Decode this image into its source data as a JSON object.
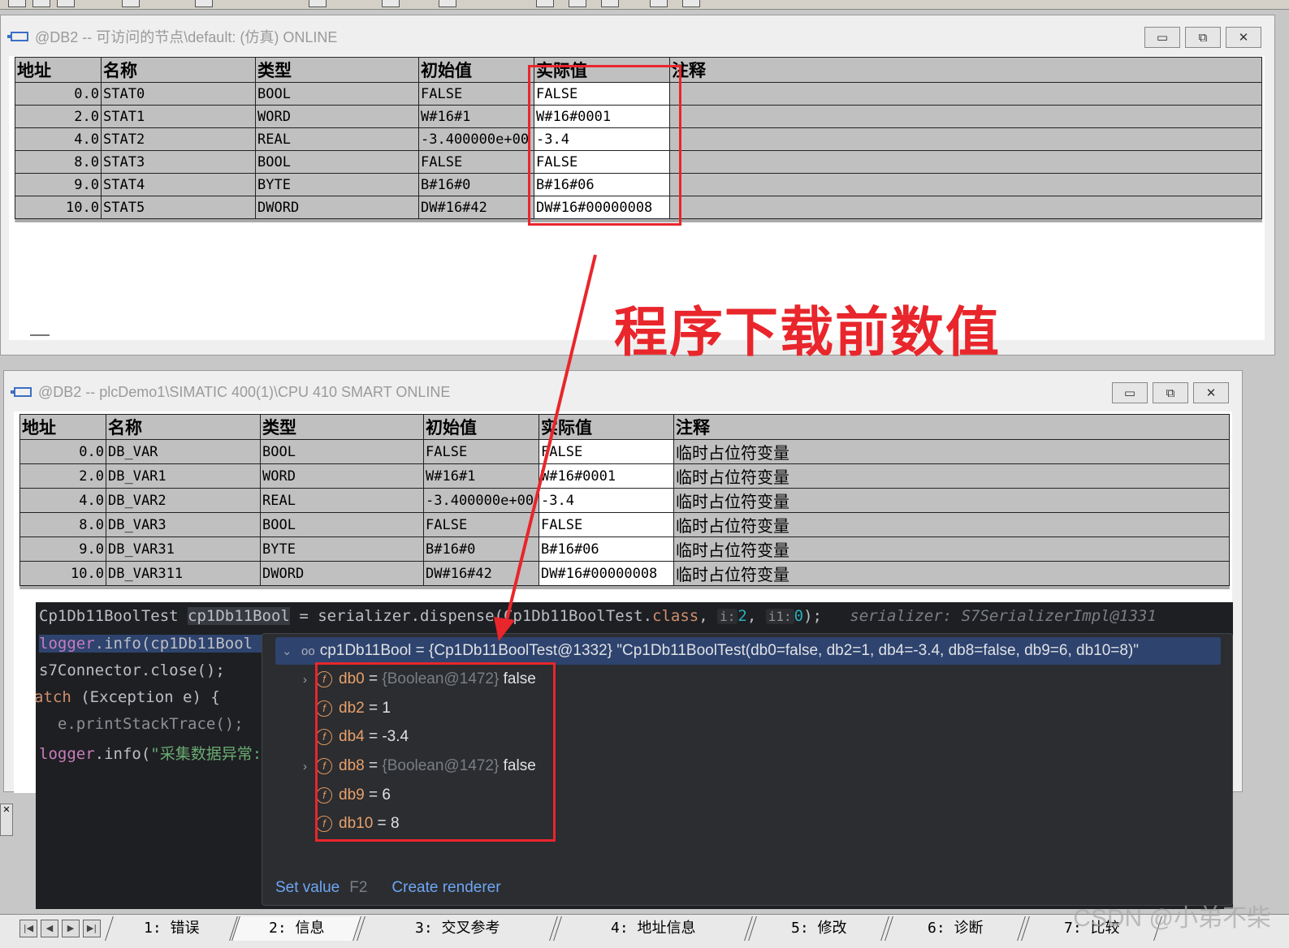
{
  "window1": {
    "title": "@DB2 -- 可访问的节点\\default:  (仿真)  ONLINE",
    "headers": [
      "地址",
      "名称",
      "类型",
      "初始值",
      "实际值",
      "注释"
    ],
    "rows": [
      {
        "addr": "0.0",
        "name": "STAT0",
        "type": "BOOL",
        "init": "FALSE",
        "actual": "FALSE",
        "comment": ""
      },
      {
        "addr": "2.0",
        "name": "STAT1",
        "type": "WORD",
        "init": "W#16#1",
        "actual": "W#16#0001",
        "comment": ""
      },
      {
        "addr": "4.0",
        "name": "STAT2",
        "type": "REAL",
        "init": "-3.400000e+00",
        "actual": "-3.4",
        "comment": ""
      },
      {
        "addr": "8.0",
        "name": "STAT3",
        "type": "BOOL",
        "init": "FALSE",
        "actual": "FALSE",
        "comment": ""
      },
      {
        "addr": "9.0",
        "name": "STAT4",
        "type": "BYTE",
        "init": "B#16#0",
        "actual": "B#16#06",
        "comment": ""
      },
      {
        "addr": "10.0",
        "name": "STAT5",
        "type": "DWORD",
        "init": "DW#16#42",
        "actual": "DW#16#00000008",
        "comment": ""
      }
    ]
  },
  "window2": {
    "title": "@DB2 -- plcDemo1\\SIMATIC 400(1)\\CPU 410 SMART  ONLINE",
    "headers": [
      "地址",
      "名称",
      "类型",
      "初始值",
      "实际值",
      "注释"
    ],
    "rows": [
      {
        "addr": "0.0",
        "name": "DB_VAR",
        "type": "BOOL",
        "init": "FALSE",
        "actual": "FALSE",
        "comment": "临时占位符变量"
      },
      {
        "addr": "2.0",
        "name": "DB_VAR1",
        "type": "WORD",
        "init": "W#16#1",
        "actual": "W#16#0001",
        "comment": "临时占位符变量"
      },
      {
        "addr": "4.0",
        "name": "DB_VAR2",
        "type": "REAL",
        "init": "-3.400000e+00",
        "actual": "-3.4",
        "comment": "临时占位符变量"
      },
      {
        "addr": "8.0",
        "name": "DB_VAR3",
        "type": "BOOL",
        "init": "FALSE",
        "actual": "FALSE",
        "comment": "临时占位符变量"
      },
      {
        "addr": "9.0",
        "name": "DB_VAR31",
        "type": "BYTE",
        "init": "B#16#0",
        "actual": "B#16#06",
        "comment": "临时占位符变量"
      },
      {
        "addr": "10.0",
        "name": "DB_VAR311",
        "type": "DWORD",
        "init": "DW#16#42",
        "actual": "DW#16#00000008",
        "comment": "临时占位符变量"
      }
    ]
  },
  "window_buttons": {
    "minimize": "▭",
    "maximize": "⧉",
    "close": "✕"
  },
  "annotation": "程序下载前数值",
  "code": {
    "line1_type": "Cp1Db11BoolTest",
    "line1_var": "cp1Db11Bool",
    "line1_mid": " = serializer.dispense(Cp1Db11BoolTest.",
    "line1_class": "class",
    "line1_comma": ", ",
    "inlay_i": "i:",
    "line1_num1": "2",
    "line1_comma2": ", ",
    "inlay_i1": "i1:",
    "line1_num2": "0",
    "line1_end": ");",
    "line1_hint": "serializer: S7SerializerImpl@1331",
    "line2_obj": "logger",
    "line2_fn": ".info(",
    "line2_arg": "cp1Db11Bool",
    "line3": "s7Connector.close();",
    "line4_kw": "atch",
    "line4_rest": " (Exception e) {",
    "line5": "  e.printStackTrace();",
    "line6_obj": "logger",
    "line6_fn": ".info(",
    "line6_str": "\"采集数据异常:"
  },
  "popup": {
    "expand_chevron": "⌄",
    "watch_icon": "oo",
    "header": "cp1Db11Bool = {Cp1Db11BoolTest@1332} \"Cp1Db11BoolTest(db0=false, db2=1, db4=-3.4, db8=false, db9=6, db10=8)\"",
    "fields": [
      {
        "chevron": "›",
        "name": "db0",
        "eq": " = ",
        "ref": "{Boolean@1472}",
        "value": " false"
      },
      {
        "chevron": "",
        "name": "db2",
        "eq": " = ",
        "ref": "",
        "value": "1"
      },
      {
        "chevron": "",
        "name": "db4",
        "eq": " = ",
        "ref": "",
        "value": "-3.4"
      },
      {
        "chevron": "›",
        "name": "db8",
        "eq": " = ",
        "ref": "{Boolean@1472}",
        "value": " false"
      },
      {
        "chevron": "",
        "name": "db9",
        "eq": " = ",
        "ref": "",
        "value": "6"
      },
      {
        "chevron": "",
        "name": "db10",
        "eq": " = ",
        "ref": "",
        "value": "8"
      }
    ],
    "field_badge": "f",
    "set_value": "Set value",
    "set_value_key": "F2",
    "create_renderer": "Create renderer"
  },
  "bottom_tabs": [
    "1: 错误",
    "2: 信息",
    "3: 交叉参考",
    "4: 地址信息",
    "5: 修改",
    "6: 诊断",
    "7: 比较"
  ],
  "nav_buttons": [
    "|◀",
    "◀",
    "▶",
    "▶|"
  ],
  "left_close": "✕",
  "watermark": "CSDN @小弟不柴",
  "colors": {
    "annotation_red": "#e8262b",
    "ide_bg": "#1e1f22",
    "popup_header": "#2e436e"
  }
}
